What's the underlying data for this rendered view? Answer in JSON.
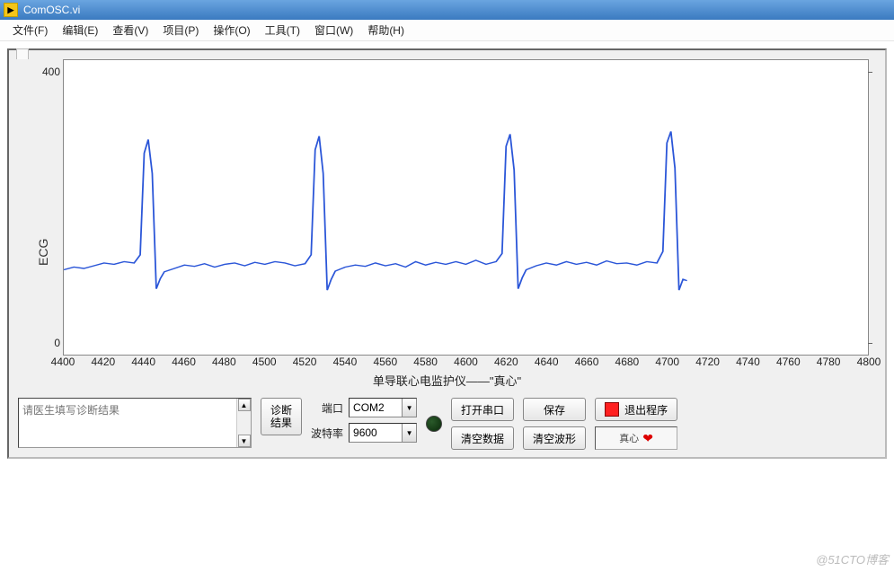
{
  "window": {
    "title": "ComOSC.vi"
  },
  "menu": [
    "文件(F)",
    "编辑(E)",
    "查看(V)",
    "项目(P)",
    "操作(O)",
    "工具(T)",
    "窗口(W)",
    "帮助(H)"
  ],
  "chart_data": {
    "type": "line",
    "title": "单导联心电监护仪——\"真心\"",
    "ylabel": "ECG",
    "xlim": [
      4400,
      4800
    ],
    "ylim": [
      0,
      400
    ],
    "x_ticks": [
      4400,
      4420,
      4440,
      4460,
      4480,
      4500,
      4520,
      4540,
      4560,
      4580,
      4600,
      4620,
      4640,
      4660,
      4680,
      4700,
      4720,
      4740,
      4760,
      4780,
      4800
    ],
    "y_ticks": [
      0,
      400
    ],
    "series": [
      {
        "name": "ECG",
        "x": [
          4400,
          4405,
          4410,
          4415,
          4420,
          4425,
          4430,
          4435,
          4438,
          4440,
          4442,
          4444,
          4446,
          4448,
          4450,
          4455,
          4460,
          4465,
          4470,
          4475,
          4480,
          4485,
          4490,
          4495,
          4500,
          4505,
          4510,
          4515,
          4520,
          4523,
          4525,
          4527,
          4529,
          4531,
          4533,
          4535,
          4540,
          4545,
          4550,
          4555,
          4560,
          4565,
          4570,
          4575,
          4580,
          4585,
          4590,
          4595,
          4600,
          4605,
          4610,
          4615,
          4618,
          4620,
          4622,
          4624,
          4626,
          4628,
          4630,
          4635,
          4640,
          4645,
          4650,
          4655,
          4660,
          4665,
          4670,
          4675,
          4680,
          4685,
          4690,
          4695,
          4698,
          4700,
          4702,
          4704,
          4706,
          4708,
          4710
        ],
        "y": [
          108,
          112,
          110,
          114,
          118,
          116,
          120,
          118,
          130,
          280,
          300,
          250,
          80,
          95,
          105,
          110,
          115,
          113,
          117,
          112,
          116,
          118,
          114,
          119,
          116,
          120,
          118,
          114,
          117,
          130,
          285,
          305,
          250,
          78,
          94,
          106,
          112,
          115,
          113,
          118,
          114,
          117,
          112,
          120,
          115,
          119,
          116,
          120,
          116,
          122,
          116,
          120,
          132,
          290,
          308,
          255,
          80,
          96,
          108,
          114,
          118,
          115,
          120,
          116,
          119,
          115,
          121,
          117,
          118,
          115,
          120,
          118,
          135,
          295,
          312,
          258,
          78,
          94,
          92
        ]
      }
    ]
  },
  "diag": {
    "placeholder": "请医生填写诊断结果"
  },
  "buttons": {
    "diag_result": "诊断\n结果",
    "open_port": "打开串口",
    "save": "保存",
    "exit": "退出程序",
    "clear_data": "清空数据",
    "clear_wave": "清空波形"
  },
  "io": {
    "port_label": "端口",
    "port_value": "COM2",
    "baud_label": "波特率",
    "baud_value": "9600"
  },
  "logo_text": "真心",
  "watermark": "@51CTO博客"
}
